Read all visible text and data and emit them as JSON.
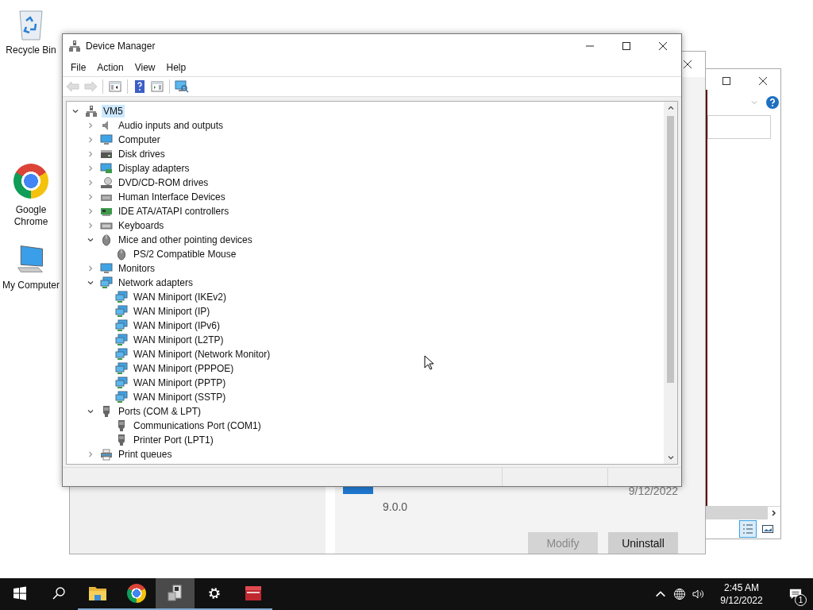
{
  "desktop_icons": [
    {
      "label": "Recycle Bin",
      "kind": "recycle"
    },
    {
      "label": "Google Chrome",
      "kind": "chrome"
    },
    {
      "label": "My Computer",
      "kind": "computer"
    }
  ],
  "programs_window": {
    "version": "9.0.0",
    "date": "9/12/2022",
    "buttons": [
      {
        "label": "Modify",
        "disabled": true
      },
      {
        "label": "Uninstall",
        "disabled": false
      }
    ]
  },
  "device_manager": {
    "title": "Device Manager",
    "menu": [
      "File",
      "Action",
      "View",
      "Help"
    ],
    "toolbar": [
      {
        "kind": "back",
        "disabled": true
      },
      {
        "kind": "forward",
        "disabled": true
      },
      {
        "kind": "console-tree",
        "disabled": false
      },
      {
        "kind": "help",
        "disabled": false
      },
      {
        "kind": "properties",
        "disabled": false
      },
      {
        "kind": "scan",
        "disabled": false
      }
    ],
    "tree": {
      "label": "VM5",
      "kind": "root",
      "selected": true,
      "expanded": true,
      "children": [
        {
          "label": "Audio inputs and outputs",
          "kind": "audio",
          "selected": false,
          "expanded": false
        },
        {
          "label": "Computer",
          "kind": "computer",
          "selected": false,
          "expanded": false
        },
        {
          "label": "Disk drives",
          "kind": "disk",
          "selected": false,
          "expanded": false
        },
        {
          "label": "Display adapters",
          "kind": "display",
          "selected": false,
          "expanded": false
        },
        {
          "label": "DVD/CD-ROM drives",
          "kind": "dvd",
          "selected": false,
          "expanded": false
        },
        {
          "label": "Human Interface Devices",
          "kind": "hid",
          "selected": false,
          "expanded": false
        },
        {
          "label": "IDE ATA/ATAPI controllers",
          "kind": "ide",
          "selected": false,
          "expanded": false
        },
        {
          "label": "Keyboards",
          "kind": "keyboard",
          "selected": false,
          "expanded": false
        },
        {
          "label": "Mice and other pointing devices",
          "kind": "mouse",
          "selected": false,
          "expanded": true,
          "children": [
            {
              "label": "PS/2 Compatible Mouse",
              "kind": "mouse",
              "selected": false
            }
          ]
        },
        {
          "label": "Monitors",
          "kind": "computer",
          "selected": false,
          "expanded": false
        },
        {
          "label": "Network adapters",
          "kind": "network",
          "selected": false,
          "expanded": true,
          "children": [
            {
              "label": "WAN Miniport (IKEv2)",
              "kind": "network",
              "selected": false
            },
            {
              "label": "WAN Miniport (IP)",
              "kind": "network",
              "selected": false
            },
            {
              "label": "WAN Miniport (IPv6)",
              "kind": "network",
              "selected": false
            },
            {
              "label": "WAN Miniport (L2TP)",
              "kind": "network",
              "selected": false
            },
            {
              "label": "WAN Miniport (Network Monitor)",
              "kind": "network",
              "selected": false
            },
            {
              "label": "WAN Miniport (PPPOE)",
              "kind": "network",
              "selected": false
            },
            {
              "label": "WAN Miniport (PPTP)",
              "kind": "network",
              "selected": false
            },
            {
              "label": "WAN Miniport (SSTP)",
              "kind": "network",
              "selected": false
            }
          ]
        },
        {
          "label": "Ports (COM & LPT)",
          "kind": "port",
          "selected": false,
          "expanded": true,
          "children": [
            {
              "label": "Communications Port (COM1)",
              "kind": "port",
              "selected": false
            },
            {
              "label": "Printer Port (LPT1)",
              "kind": "port",
              "selected": false
            }
          ]
        },
        {
          "label": "Print queues",
          "kind": "printer",
          "selected": false,
          "expanded": false
        }
      ]
    }
  },
  "taskbar": {
    "apps": [
      {
        "kind": "start",
        "active": false,
        "running": false
      },
      {
        "kind": "search",
        "active": false,
        "running": false
      },
      {
        "kind": "explorer",
        "active": false,
        "running": true
      },
      {
        "kind": "chrome",
        "active": false,
        "running": true
      },
      {
        "kind": "device-manager",
        "active": true,
        "running": true
      },
      {
        "kind": "settings",
        "active": false,
        "running": true
      },
      {
        "kind": "archive",
        "active": false,
        "running": true
      }
    ],
    "time": "2:45 AM",
    "date": "9/12/2022",
    "notification_count": "1"
  }
}
